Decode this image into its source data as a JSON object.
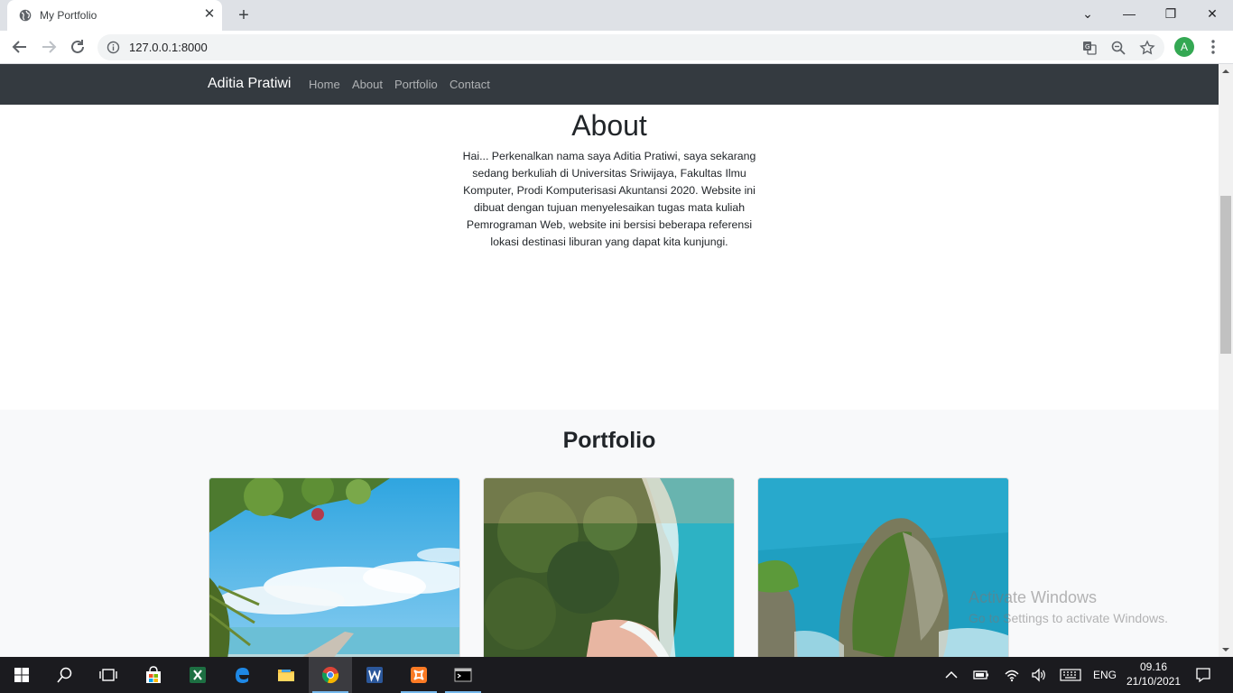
{
  "browser": {
    "tab": {
      "title": "My Portfolio",
      "close_glyph": "✕"
    },
    "newtab_glyph": "+",
    "url": "127.0.0.1:8000",
    "profile_initial": "A",
    "window_controls": {
      "minimize": "—",
      "maximize": "❐",
      "close": "✕",
      "tabsearch": "⌄"
    }
  },
  "site": {
    "brand": "Aditia Pratiwi",
    "nav": [
      "Home",
      "About",
      "Portfolio",
      "Contact"
    ],
    "about": {
      "title": "About",
      "text": "Hai... Perkenalkan nama saya Aditia Pratiwi, saya sekarang sedang berkuliah di Universitas Sriwijaya, Fakultas Ilmu Komputer, Prodi Komputerisasi Akuntansi 2020. Website ini dibuat dengan tujuan menyelesaikan tugas mata kuliah Pemrograman Web, website ini bersisi beberapa referensi lokasi destinasi liburan yang dapat kita kunjungi."
    },
    "portfolio": {
      "title": "Portfolio",
      "cards": [
        "beach-pier-photo",
        "aerial-beach-cliff-photo",
        "sea-rock-cliff-photo"
      ]
    }
  },
  "watermark": {
    "line1": "Activate Windows",
    "line2": "Go to Settings to activate Windows."
  },
  "taskbar": {
    "language": "ENG",
    "time": "09.16",
    "date": "21/10/2021"
  },
  "colors": {
    "navbar": "#343a40",
    "section_bg": "#f8f9fa",
    "taskbar": "#1b1b1f",
    "accent": "#76b9ed"
  }
}
